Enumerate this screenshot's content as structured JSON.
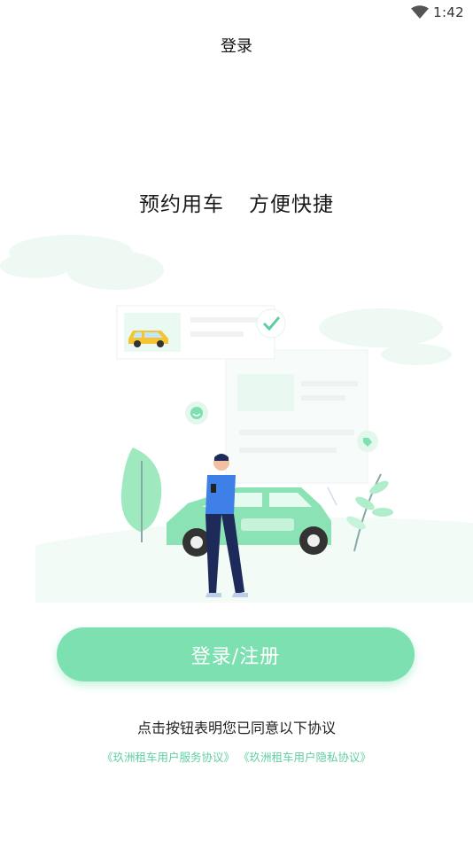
{
  "status_bar": {
    "time": "1:42",
    "icons": [
      "wifi-icon"
    ]
  },
  "nav": {
    "title": "登录"
  },
  "hero": {
    "slogan_left": "预约用车",
    "slogan_right": "方便快捷"
  },
  "actions": {
    "login_label": "登录/注册"
  },
  "agreement": {
    "text": "点击按钮表明您已同意以下协议",
    "service_link": "《玖洲租车用户服务协议》",
    "privacy_link": "《玖洲租车用户隐私协议》"
  },
  "colors": {
    "accent": "#7de0b1",
    "link": "#5fcfa1",
    "person_shirt": "#3f7fe8",
    "person_pants": "#1e2a5a"
  }
}
